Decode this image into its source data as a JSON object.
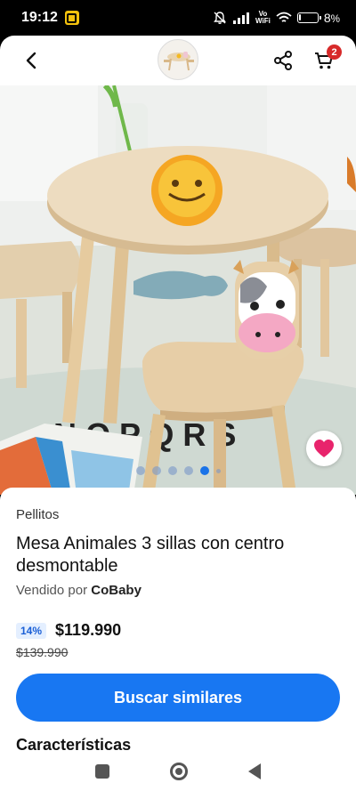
{
  "status_bar": {
    "time": "19:12",
    "battery_text": "8",
    "battery_level": 0.08,
    "vowifi_top": "Vo",
    "vowifi_bottom": "WiFi"
  },
  "header": {
    "back_icon": "chevron-left-icon",
    "share_icon": "share-icon",
    "cart_icon": "cart-icon",
    "cart_count": "2"
  },
  "gallery": {
    "image_count": 6,
    "active_index": 4
  },
  "product": {
    "brand": "Pellitos",
    "title": "Mesa Animales 3 sillas con centro desmontable",
    "sold_by_prefix": "Vendido por",
    "seller": "CoBaby",
    "discount": "14%",
    "price": "$119.990",
    "old_price": "$139.990",
    "search_button": "Buscar similares",
    "features_title": "Características"
  },
  "colors": {
    "accent": "#1877f2",
    "badge": "#d72a2a",
    "heart": "#e8246c"
  }
}
